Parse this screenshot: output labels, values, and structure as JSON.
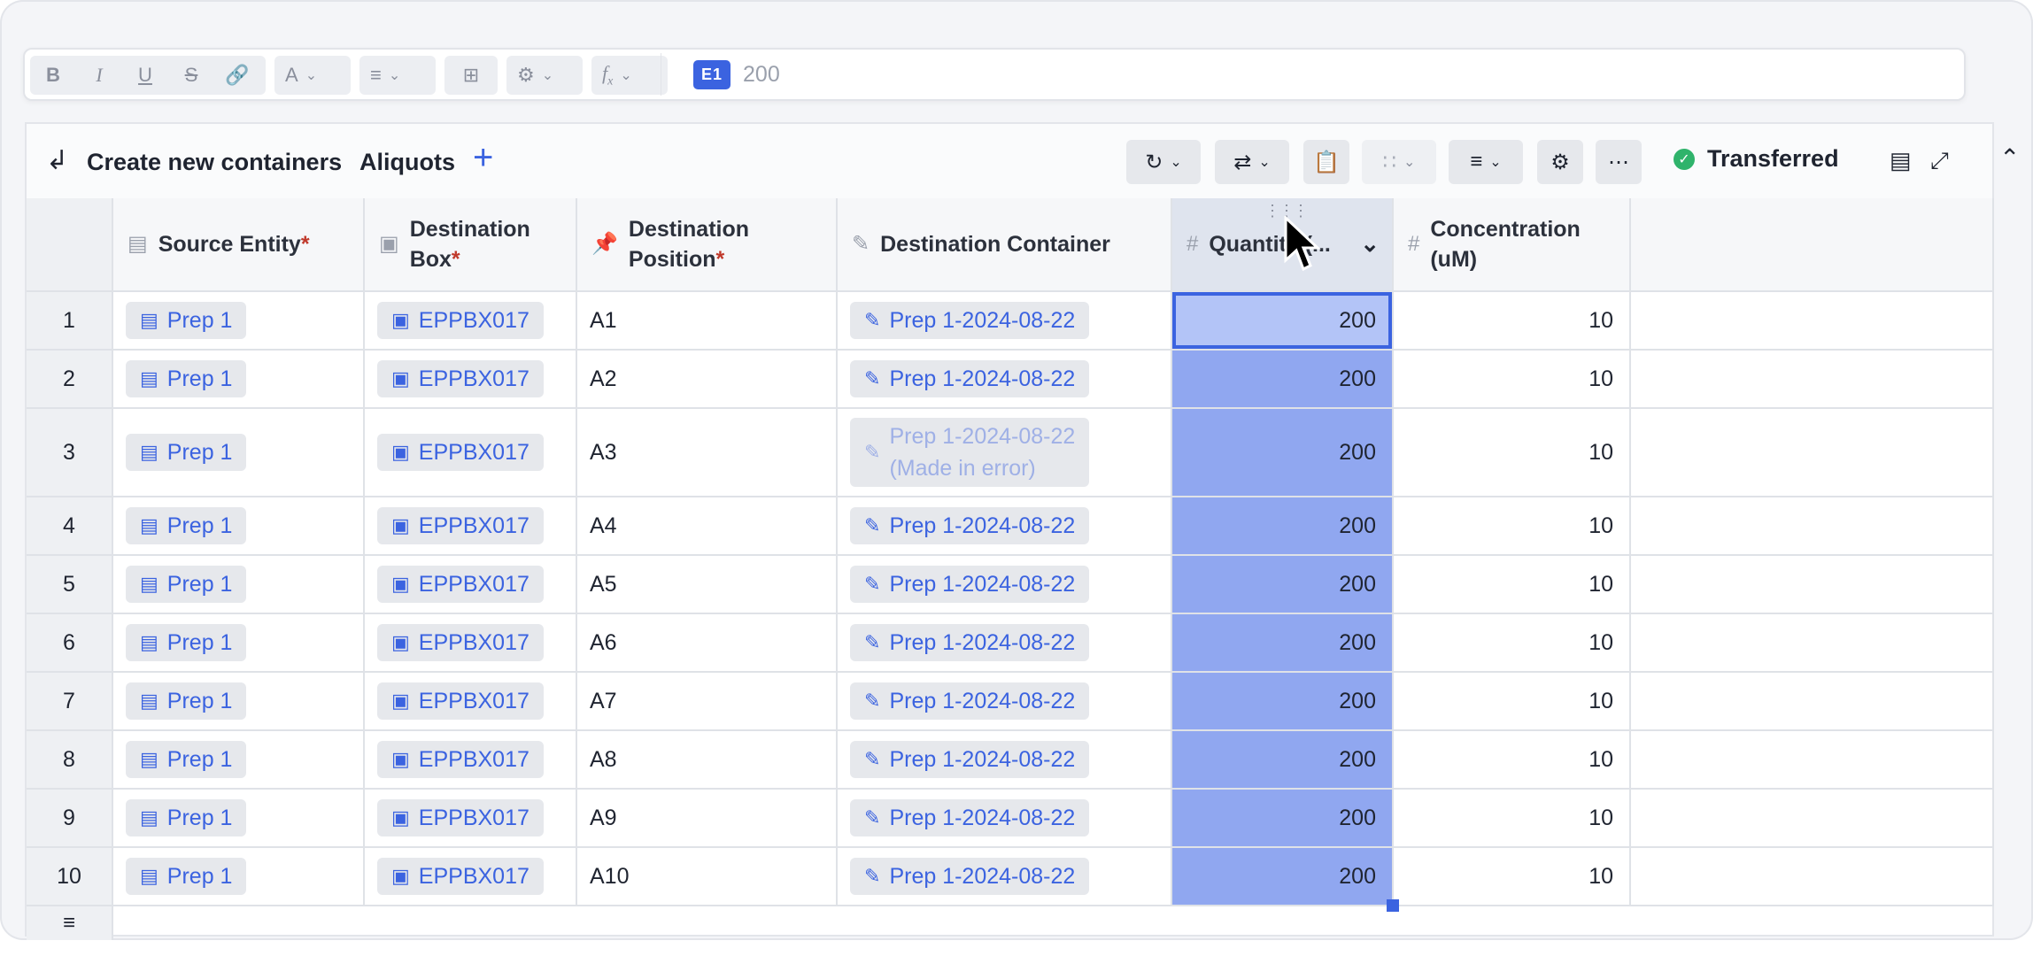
{
  "toolbar": {
    "bold": "B",
    "italic": "I",
    "underline": "U",
    "strike": "S",
    "cell_ref": "E1",
    "formula_value": "200"
  },
  "panel": {
    "title": "Create new containers",
    "tab": "Aliquots",
    "add_label": "+",
    "status": "Transferred"
  },
  "columns": [
    {
      "label": "Source Entity",
      "required": "*"
    },
    {
      "label_1": "Destination",
      "label_2": "Box",
      "required": "*"
    },
    {
      "label_1": "Destination",
      "label_2": "Position",
      "required": "*"
    },
    {
      "label": "Destination Container"
    },
    {
      "label": "Quantity (..."
    },
    {
      "label_1": "Concentration",
      "label_2": "(uM)"
    }
  ],
  "rows": [
    {
      "n": "1",
      "source": "Prep 1",
      "box": "EPPBX017",
      "position": "A1",
      "container": "Prep 1-2024-08-22",
      "quantity": "200",
      "concentration": "10"
    },
    {
      "n": "2",
      "source": "Prep 1",
      "box": "EPPBX017",
      "position": "A2",
      "container": "Prep 1-2024-08-22",
      "quantity": "200",
      "concentration": "10"
    },
    {
      "n": "3",
      "source": "Prep 1",
      "box": "EPPBX017",
      "position": "A3",
      "container": "Prep 1-2024-08-22",
      "container_note": "(Made in error)",
      "quantity": "200",
      "concentration": "10"
    },
    {
      "n": "4",
      "source": "Prep 1",
      "box": "EPPBX017",
      "position": "A4",
      "container": "Prep 1-2024-08-22",
      "quantity": "200",
      "concentration": "10"
    },
    {
      "n": "5",
      "source": "Prep 1",
      "box": "EPPBX017",
      "position": "A5",
      "container": "Prep 1-2024-08-22",
      "quantity": "200",
      "concentration": "10"
    },
    {
      "n": "6",
      "source": "Prep 1",
      "box": "EPPBX017",
      "position": "A6",
      "container": "Prep 1-2024-08-22",
      "quantity": "200",
      "concentration": "10"
    },
    {
      "n": "7",
      "source": "Prep 1",
      "box": "EPPBX017",
      "position": "A7",
      "container": "Prep 1-2024-08-22",
      "quantity": "200",
      "concentration": "10"
    },
    {
      "n": "8",
      "source": "Prep 1",
      "box": "EPPBX017",
      "position": "A8",
      "container": "Prep 1-2024-08-22",
      "quantity": "200",
      "concentration": "10"
    },
    {
      "n": "9",
      "source": "Prep 1",
      "box": "EPPBX017",
      "position": "A9",
      "container": "Prep 1-2024-08-22",
      "quantity": "200",
      "concentration": "10"
    },
    {
      "n": "10",
      "source": "Prep 1",
      "box": "EPPBX017",
      "position": "A10",
      "container": "Prep 1-2024-08-22",
      "quantity": "200",
      "concentration": "10"
    }
  ],
  "colors": {
    "accent": "#3b63e0",
    "selection": "#90a7f0",
    "status_ok": "#2fb36b"
  },
  "icons": [
    "bold-icon",
    "italic-icon",
    "underline-icon",
    "strikethrough-icon",
    "link-icon",
    "text-color-icon",
    "align-icon",
    "table-icon",
    "gear-icon",
    "function-icon",
    "refresh-icon",
    "swap-icon",
    "clipboard-check-icon",
    "grid-icon",
    "filter-icon",
    "more-icon",
    "minimize-panel-icon",
    "expand-icon",
    "chevron-up-icon",
    "menu-icon"
  ]
}
